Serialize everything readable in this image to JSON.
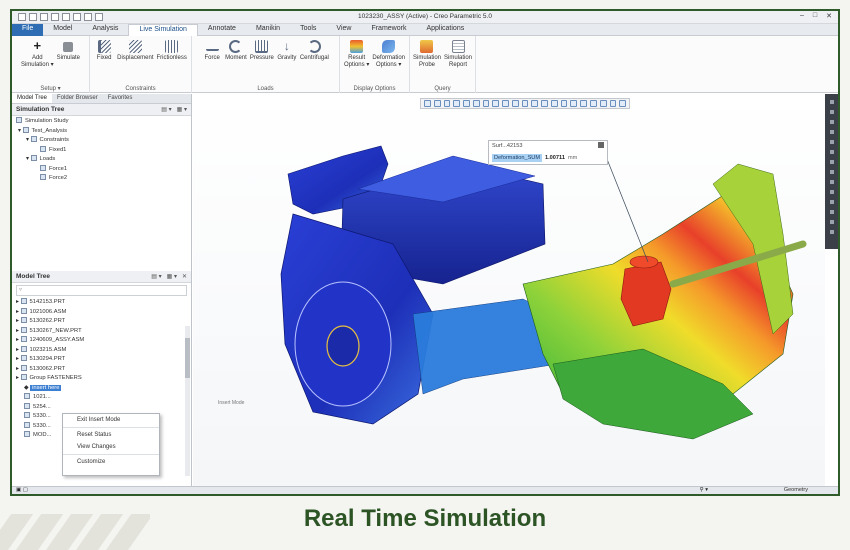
{
  "window": {
    "title": "1023230_ASSY (Active) - Creo Parametric 5.0"
  },
  "ribbon_tabs": [
    {
      "label": "File"
    },
    {
      "label": "Model"
    },
    {
      "label": "Analysis"
    },
    {
      "label": "Live Simulation"
    },
    {
      "label": "Annotate"
    },
    {
      "label": "Manikin"
    },
    {
      "label": "Tools"
    },
    {
      "label": "View"
    },
    {
      "label": "Framework"
    },
    {
      "label": "Applications"
    }
  ],
  "ribbon_groups": {
    "setup": {
      "label": "Setup ▾",
      "buttons": [
        {
          "label": "Add\nSimulation ▾"
        },
        {
          "label": "Simulate"
        }
      ]
    },
    "constraints": {
      "label": "Constraints",
      "buttons": [
        {
          "label": "Fixed"
        },
        {
          "label": "Displacement"
        },
        {
          "label": "Frictionless"
        }
      ]
    },
    "loads": {
      "label": "Loads",
      "buttons": [
        {
          "label": "Force"
        },
        {
          "label": "Moment"
        },
        {
          "label": "Pressure"
        },
        {
          "label": "Gravity"
        },
        {
          "label": "Centrifugal"
        }
      ]
    },
    "display": {
      "label": "Display Options",
      "buttons": [
        {
          "label": "Result\nOptions ▾"
        },
        {
          "label": "Deformation\nOptions ▾"
        }
      ]
    },
    "query": {
      "label": "Query",
      "buttons": [
        {
          "label": "Simulation\nProbe"
        },
        {
          "label": "Simulation\nReport"
        }
      ]
    }
  },
  "panel_tabs": [
    {
      "label": "Model Tree"
    },
    {
      "label": "Folder Browser"
    },
    {
      "label": "Favorites"
    }
  ],
  "simulation_tree": {
    "header": "Simulation Tree",
    "items": [
      {
        "label": "Simulation Study"
      },
      {
        "label": "Test_Analysis"
      },
      {
        "label": "Constraints"
      },
      {
        "label": "Fixed1"
      },
      {
        "label": "Loads"
      },
      {
        "label": "Force1"
      },
      {
        "label": "Force2"
      }
    ]
  },
  "model_tree": {
    "header": "Model Tree",
    "items": [
      {
        "label": "5142153.PRT"
      },
      {
        "label": "1021006.ASM"
      },
      {
        "label": "5130262.PRT"
      },
      {
        "label": "5130267_NEW.PRT"
      },
      {
        "label": "1240609_ASSY.ASM"
      },
      {
        "label": "1023215.ASM"
      },
      {
        "label": "5130294.PRT"
      },
      {
        "label": "5130062.PRT"
      },
      {
        "label": "Group FASTENERS"
      },
      {
        "label": "insert here"
      },
      {
        "label": "1021..."
      },
      {
        "label": "5254..."
      },
      {
        "label": "5330..."
      },
      {
        "label": "5330..."
      },
      {
        "label": "MOD..."
      }
    ]
  },
  "context_menu": {
    "items": [
      {
        "label": "Exit Insert Mode"
      },
      {
        "label": "Reset Status"
      },
      {
        "label": "View Changes"
      },
      {
        "label": "Customize"
      }
    ]
  },
  "probe": {
    "name": "Surf...42153",
    "quantity": "Deformation_SUM",
    "value": "1.00711",
    "unit": "mm"
  },
  "viewport": {
    "insert_mode_label": "Insert Mode"
  },
  "status": {
    "geometry": "Geometry"
  },
  "caption": "Real Time Simulation",
  "colors": {
    "frame": "#2f5a2a",
    "caption": "#2c5425",
    "file_tab": "#2e6db4"
  }
}
